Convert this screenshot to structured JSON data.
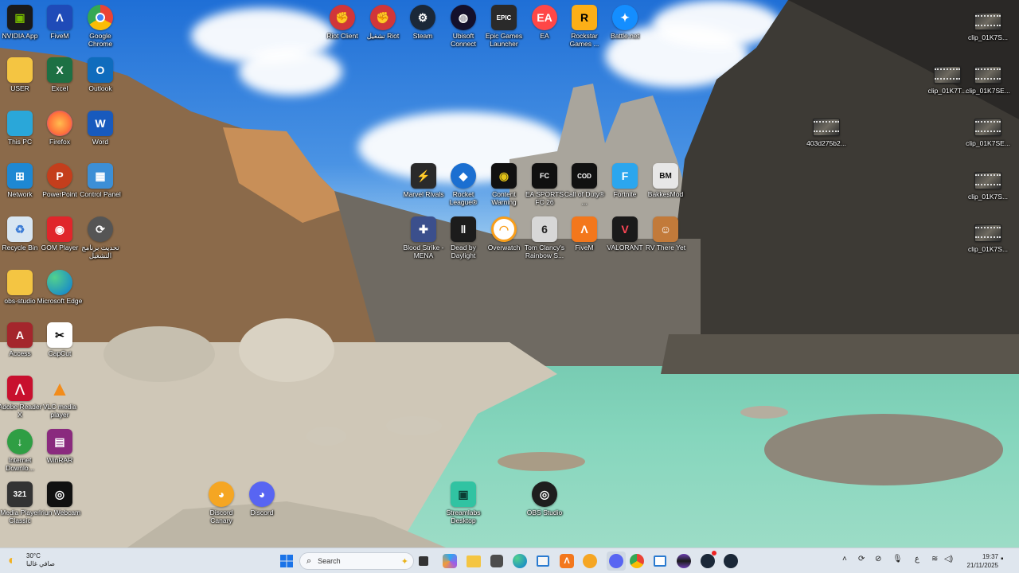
{
  "desktop": {
    "left_column": [
      {
        "label": "NVIDIA App",
        "icon": "nvidia-icon",
        "color": "#76b900"
      },
      {
        "label": "USER",
        "icon": "folder-icon",
        "color": "#f4c542"
      },
      {
        "label": "This PC",
        "icon": "monitor-icon",
        "color": "#2aa7d9"
      },
      {
        "label": "Network",
        "icon": "network-icon",
        "color": "#1e88d3"
      },
      {
        "label": "Recycle Bin",
        "icon": "recycle-bin-icon",
        "color": "#d8e6f2"
      },
      {
        "label": "obs-studio",
        "icon": "folder-icon",
        "color": "#f4c542"
      },
      {
        "label": "Access",
        "icon": "access-icon",
        "color": "#a4262c"
      },
      {
        "label": "Adobe Reader X",
        "icon": "adobe-reader-icon",
        "color": "#c8102e"
      },
      {
        "label": "Internet Downlo...",
        "icon": "idm-icon",
        "color": "#2f9e44"
      },
      {
        "label": "Media Player Classic",
        "icon": "mpc-icon",
        "color": "#333333"
      }
    ],
    "second_column": [
      {
        "label": "FiveM",
        "icon": "fivem-icon",
        "color": "#1f4bb8"
      },
      {
        "label": "Excel",
        "icon": "excel-icon",
        "color": "#1d7044"
      },
      {
        "label": "Firefox",
        "icon": "firefox-icon",
        "color": "#ff7139"
      },
      {
        "label": "PowerPoint",
        "icon": "powerpoint-icon",
        "color": "#c43e1c"
      },
      {
        "label": "GOM Player",
        "icon": "gom-player-icon",
        "color": "#e0262b"
      },
      {
        "label": "Microsoft Edge",
        "icon": "edge-icon",
        "color": "#0c7bd6"
      },
      {
        "label": "CapCut",
        "icon": "capcut-icon",
        "color": "#ffffff"
      },
      {
        "label": "VLC media player",
        "icon": "vlc-icon",
        "color": "#f28c1b"
      },
      {
        "label": "WinRAR",
        "icon": "winrar-icon",
        "color": "#8a2a7e"
      },
      {
        "label": "Iriun Webcam",
        "icon": "webcam-icon",
        "color": "#111111"
      }
    ],
    "third_column": [
      {
        "label": "Google Chrome",
        "icon": "chrome-icon",
        "color": "#4285f4"
      },
      {
        "label": "Outlook",
        "icon": "outlook-icon",
        "color": "#0f6cbd"
      },
      {
        "label": "Word",
        "icon": "word-icon",
        "color": "#185abd"
      },
      {
        "label": "Control Panel",
        "icon": "control-panel-icon",
        "color": "#3c8fd6"
      },
      {
        "label": "تحديث برنامج التشغيل",
        "icon": "driver-update-icon",
        "color": "#555555"
      }
    ],
    "top_row": [
      {
        "label": "Riot Client",
        "icon": "riot-icon",
        "color": "#d13639"
      },
      {
        "label": "تشغيل Riot",
        "icon": "riot-icon",
        "color": "#d13639"
      },
      {
        "label": "Steam",
        "icon": "steam-icon",
        "color": "#1b2838"
      },
      {
        "label": "Ubisoft Connect",
        "icon": "ubisoft-icon",
        "color": "#14102b"
      },
      {
        "label": "Epic Games Launcher",
        "icon": "epic-games-icon",
        "color": "#2a2a2a"
      },
      {
        "label": "EA",
        "icon": "ea-icon",
        "color": "#ff4747"
      },
      {
        "label": "Rockstar Games ...",
        "icon": "rockstar-icon",
        "color": "#fcaf17"
      },
      {
        "label": "Battle.net",
        "icon": "battlenet-icon",
        "color": "#148eff"
      }
    ],
    "games_row1": [
      {
        "label": "Marvel Rivals",
        "icon": "marvel-rivals-icon",
        "color": "#2a2a2a"
      },
      {
        "label": "Rocket League®",
        "icon": "rocket-league-icon",
        "color": "#1b6fd1"
      },
      {
        "label": "Content Warning",
        "icon": "content-warning-icon",
        "color": "#e3c418"
      },
      {
        "label": "EA SPORTS FC 26",
        "icon": "fc26-icon",
        "color": "#101010"
      },
      {
        "label": "Call of Duty® ...",
        "icon": "cod-icon",
        "color": "#111111"
      },
      {
        "label": "Fortnite",
        "icon": "fortnite-icon",
        "color": "#2ba6ee"
      },
      {
        "label": "BakkesMod",
        "icon": "bakkesmod-icon",
        "color": "#e7e7e7"
      }
    ],
    "games_row2": [
      {
        "label": "Blood Strike - MENA",
        "icon": "blood-strike-icon",
        "color": "#3b4f8c"
      },
      {
        "label": "Dead by Daylight",
        "icon": "dbd-icon",
        "color": "#1c1c1c"
      },
      {
        "label": "Overwatch",
        "icon": "overwatch-icon",
        "color": "#f99e1a"
      },
      {
        "label": "Tom Clancy's Rainbow S...",
        "icon": "rainbow-six-icon",
        "color": "#d7d7d7"
      },
      {
        "label": "FiveM",
        "icon": "fivem-icon",
        "color": "#f3771c"
      },
      {
        "label": "VALORANT",
        "icon": "valorant-icon",
        "color": "#ff4655"
      },
      {
        "label": "RV There Yet",
        "icon": "rv-there-yet-icon",
        "color": "#c27a3a"
      }
    ],
    "bottom_row": [
      {
        "label": "Discord Canary",
        "icon": "discord-canary-icon",
        "color": "#f5a623"
      },
      {
        "label": "Discord",
        "icon": "discord-icon",
        "color": "#5865f2"
      },
      {
        "label": "Streamlabs Desktop",
        "icon": "streamlabs-icon",
        "color": "#31c3a2"
      },
      {
        "label": "OBS Studio",
        "icon": "obs-icon",
        "color": "#1e1e1e"
      }
    ],
    "clips": [
      {
        "label": "clip_01K7S..."
      },
      {
        "label": "clip_01K7T..."
      },
      {
        "label": "clip_01K7SE..."
      },
      {
        "label": "403d275b2..."
      },
      {
        "label": "clip_01K7SE..."
      },
      {
        "label": "clip_01K7S..."
      },
      {
        "label": "clip_01K7S..."
      }
    ]
  },
  "taskbar": {
    "weather": {
      "temp": "30°C",
      "condition": "صافي غالبا",
      "icon": "sun-icon"
    },
    "search_placeholder": "Search",
    "pinned": [
      "windows-start-icon",
      "file-explorer-icon",
      "copilot-icon",
      "folder-icon",
      "store-icon",
      "edge-icon",
      "notepad-icon",
      "fivem-icon",
      "discord-canary-icon",
      "discord-icon",
      "chrome-icon",
      "window-icon",
      "media-icon",
      "steam-recording-icon",
      "steam-icon"
    ],
    "tray": {
      "language": "ع",
      "time": "19:37",
      "date": "21/11/2025"
    }
  }
}
